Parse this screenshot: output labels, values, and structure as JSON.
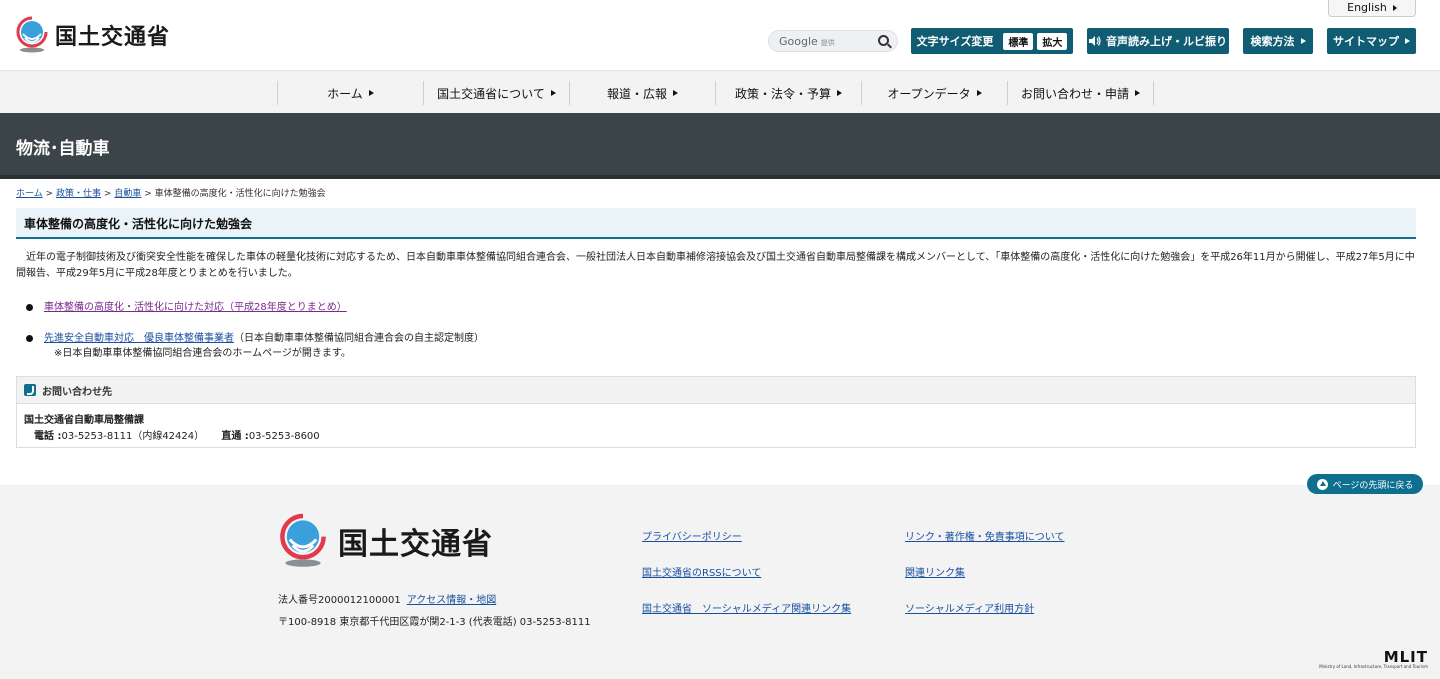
{
  "header": {
    "logo_text": "国土交通省",
    "english_label": "English",
    "search_brand": "Google",
    "search_brand_sub": "提供",
    "font_size_label": "文字サイズ変更",
    "font_size_standard": "標準",
    "font_size_large": "拡大",
    "voice_label": "音声読み上げ・ルビ振り",
    "search_method_label": "検索方法",
    "sitemap_label": "サイトマップ"
  },
  "gnav": {
    "items": [
      "ホーム",
      "国土交通省について",
      "報道・広報",
      "政策・法令・予算",
      "オープンデータ",
      "お問い合わせ・申請"
    ]
  },
  "category": {
    "title": "物流･自動車"
  },
  "breadcrumb": {
    "home": "ホーム",
    "policy": "政策・仕事",
    "auto": "自動車",
    "current": "車体整備の高度化・活性化に向けた勉強会",
    "sep": ">"
  },
  "main": {
    "title": "車体整備の高度化・活性化に向けた勉強会",
    "intro": "近年の電子制御技術及び衝突安全性能を確保した車体の軽量化技術に対応するため、日本自動車車体整備協同組合連合会、一般社団法人日本自動車補修溶接協会及び国土交通省自動車局整備課を構成メンバーとして、「車体整備の高度化・活性化に向けた勉強会」を平成26年11月から開催し、平成27年5月に中間報告、平成29年5月に平成28年度とりまとめを行いました。",
    "link1": "車体整備の高度化・活性化に向けた対応（平成28年度とりまとめ）",
    "link2": "先進安全自動車対応　優良車体整備事業者",
    "link2_suffix": "（日本自動車車体整備協同組合連合会の自主認定制度）",
    "note": "※日本自動車車体整備協同組合連合会のホームページが開きます。"
  },
  "contact": {
    "heading": "お問い合わせ先",
    "org": "国土交通省自動車局整備課",
    "tel_label": "電話 :",
    "tel_value": "03-5253-8111（内線42424）",
    "direct_label": "直通 :",
    "direct_value": "03-5253-8600"
  },
  "footer": {
    "to_top": "ページの先頭に戻る",
    "logo_text": "国土交通省",
    "corp_number": "法人番号2000012100001",
    "access": "アクセス情報・地図",
    "address": "〒100-8918 東京都千代田区霞が関2-1-3 (代表電話) 03-5253-8111",
    "links": {
      "privacy": "プライバシーポリシー",
      "rss": "国土交通省のRSSについて",
      "social_links": "国土交通省　ソーシャルメディア関連リンク集",
      "copyright": "リンク・著作権・免責事項について",
      "related": "関連リンク集",
      "social_policy": "ソーシャルメディア利用方針"
    },
    "mlit_mark": "MLIT",
    "mlit_sub": "Ministry of Land, Infrastructure, Transport and Tourism"
  },
  "colors": {
    "accent": "#0f5c73",
    "band": "#3b4448",
    "link": "#1a4fa0",
    "visited": "#7a2a8c"
  }
}
